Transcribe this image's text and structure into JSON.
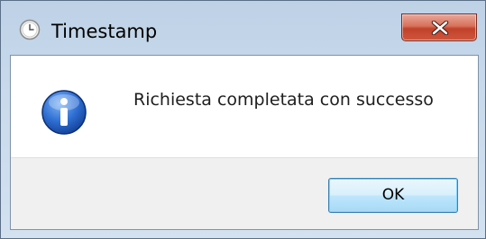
{
  "window": {
    "title": "Timestamp",
    "icon": "clock-icon",
    "close_icon": "close-icon"
  },
  "dialog": {
    "icon": "info-icon",
    "message": "Richiesta completata con successo",
    "ok_label": "OK"
  },
  "colors": {
    "close_button": "#c7442c",
    "info_icon_blue": "#1a5bbf",
    "ok_button_border": "#3c7fb1"
  }
}
